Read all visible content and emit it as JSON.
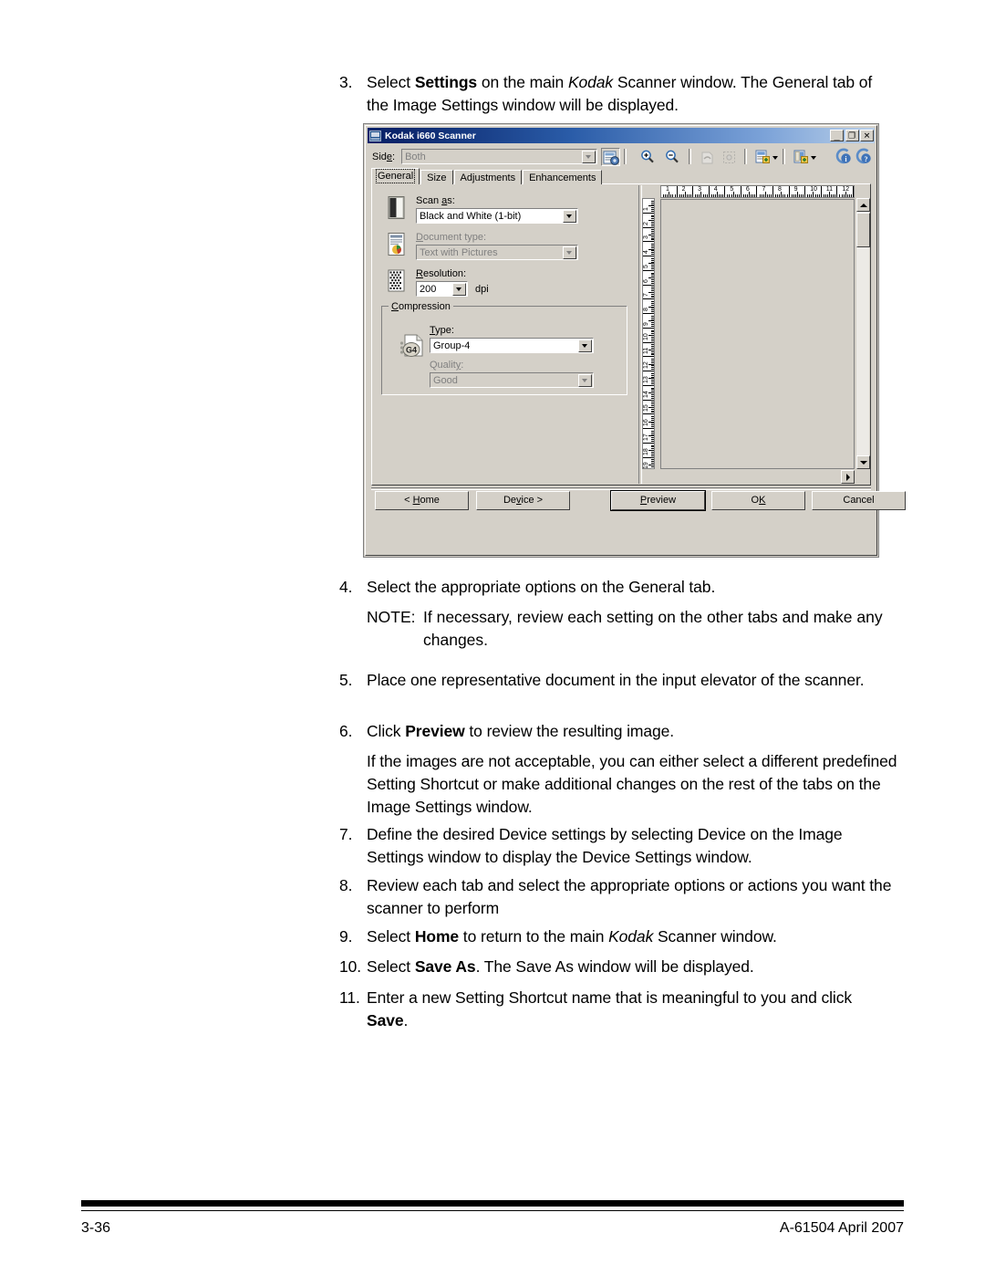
{
  "document": {
    "steps": [
      {
        "num": "3.",
        "parts": [
          {
            "t": "Select ",
            "s": "n"
          },
          {
            "t": "Settings",
            "s": "b"
          },
          {
            "t": " on the main ",
            "s": "n"
          },
          {
            "t": "Kodak",
            "s": "i"
          },
          {
            "t": " Scanner window. The General tab of the Image Settings window will be displayed.",
            "s": "n"
          }
        ]
      }
    ],
    "steps_after": [
      {
        "num": "4.",
        "parts": [
          {
            "t": "Select the appropriate options on the General tab.",
            "s": "n"
          }
        ]
      },
      {
        "num": "5.",
        "parts": [
          {
            "t": "Place one representative document in the input elevator of the scanner.",
            "s": "n"
          }
        ]
      },
      {
        "num": "6.",
        "parts": [
          {
            "t": "Click ",
            "s": "n"
          },
          {
            "t": "Preview",
            "s": "b"
          },
          {
            "t": " to review the resulting image.",
            "s": "n"
          }
        ]
      },
      {
        "num": "",
        "parts": [
          {
            "t": "If the images are not acceptable, you can either select a different predefined Setting Shortcut or make additional changes on the rest of the tabs on the Image Settings window.",
            "s": "n"
          }
        ]
      },
      {
        "num": "7.",
        "parts": [
          {
            "t": "Define the desired Device settings by selecting Device on the Image Settings window to display the Device Settings window.",
            "s": "n"
          }
        ]
      },
      {
        "num": "8.",
        "parts": [
          {
            "t": "Review each tab and select the appropriate options or actions you want the scanner to perform",
            "s": "n"
          }
        ]
      },
      {
        "num": "9.",
        "parts": [
          {
            "t": "Select ",
            "s": "n"
          },
          {
            "t": "Home",
            "s": "b"
          },
          {
            "t": " to return to the main ",
            "s": "n"
          },
          {
            "t": "Kodak",
            "s": "i"
          },
          {
            "t": " Scanner window.",
            "s": "n"
          }
        ]
      },
      {
        "num": "10.",
        "parts": [
          {
            "t": "Select ",
            "s": "n"
          },
          {
            "t": "Save As",
            "s": "b"
          },
          {
            "t": ". The Save As window will be displayed.",
            "s": "n"
          }
        ]
      },
      {
        "num": "11.",
        "parts": [
          {
            "t": "Enter a new Setting Shortcut name that is meaningful to you and click ",
            "s": "n"
          },
          {
            "t": "Save",
            "s": "b"
          },
          {
            "t": ".",
            "s": "n"
          }
        ]
      }
    ],
    "note": {
      "label": "NOTE:",
      "text": "If necessary, review each setting on the other tabs and make any changes."
    },
    "footer": {
      "page_number": "3-36",
      "doc_id": "A-61504 April 2007"
    }
  },
  "dialog": {
    "title": "Kodak i660 Scanner",
    "title_icon": "scanner-icon",
    "window_buttons": {
      "minimize": "_",
      "maximize": "❐",
      "close": "✕"
    },
    "toolbar": {
      "side_label": "Side:",
      "side_value": "Both",
      "side_disabled": true,
      "buttons": [
        {
          "name": "settings-shortcut-icon",
          "label": ""
        },
        {
          "name": "zoom-in-icon",
          "label": ""
        },
        {
          "name": "zoom-out-icon",
          "label": ""
        },
        {
          "name": "rotate-icon",
          "label": ""
        },
        {
          "name": "select-region-icon",
          "label": ""
        },
        {
          "name": "image-one-icon",
          "label": ""
        },
        {
          "name": "image-two-icon",
          "label": ""
        },
        {
          "name": "info-icon",
          "label": ""
        },
        {
          "name": "help-icon",
          "label": ""
        }
      ]
    },
    "tabs": [
      {
        "label": "General",
        "active": true
      },
      {
        "label": "Size",
        "active": false
      },
      {
        "label": "Adjustments",
        "active": false
      },
      {
        "label": "Enhancements",
        "active": false
      }
    ],
    "general": {
      "scan_as": {
        "label": "Scan as:",
        "value": "Black and White (1-bit)",
        "disabled": false,
        "icon": "scan-as-icon"
      },
      "document_type": {
        "label": "Document type:",
        "value": "Text with Pictures",
        "disabled": true,
        "icon": "document-type-icon"
      },
      "resolution": {
        "label": "Resolution:",
        "value": "200",
        "unit": "dpi",
        "disabled": false,
        "icon": "resolution-icon"
      },
      "compression": {
        "group_label": "Compression",
        "icon": "g4-compression-icon",
        "type": {
          "label": "Type:",
          "value": "Group-4",
          "disabled": false
        },
        "quality": {
          "label": "Quality:",
          "value": "Good",
          "disabled": true
        }
      }
    },
    "preview": {
      "ruler_h_labels": [
        "1",
        "2",
        "3",
        "4",
        "5",
        "6",
        "7",
        "8",
        "9",
        "10",
        "11",
        "12"
      ],
      "ruler_v_labels": [
        "1",
        "2",
        "3",
        "4",
        "5",
        "6",
        "7",
        "8",
        "9",
        "10",
        "11",
        "12",
        "13",
        "14",
        "15",
        "16",
        "17",
        "18",
        "19",
        "20"
      ]
    },
    "buttons": [
      {
        "name": "home-button",
        "label": "< Home",
        "underline_index": 2
      },
      {
        "name": "device-button",
        "label": "Device >",
        "underline_index": 2
      },
      {
        "name": "preview-button",
        "label": "Preview",
        "underline_index": 0
      },
      {
        "name": "ok-button",
        "label": "OK",
        "underline_index": 1
      },
      {
        "name": "cancel-button",
        "label": "Cancel",
        "underline_index": -1
      }
    ]
  }
}
